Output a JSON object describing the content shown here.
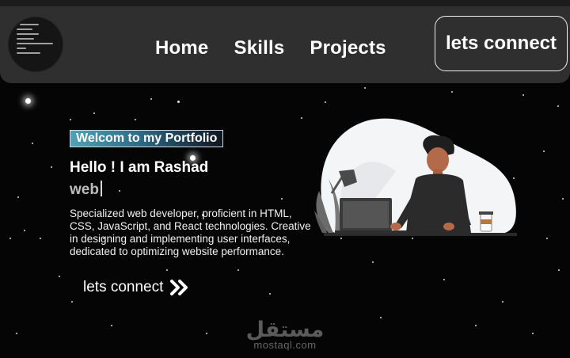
{
  "nav": {
    "links": [
      "Home",
      "Skills",
      "Projects"
    ],
    "cta_label": "lets connect"
  },
  "hero": {
    "badge": "Welcom to my Portfolio",
    "greeting": "Hello ! I am Rashad",
    "typed_text": "web",
    "description_lines": [
      "Specialized web developer, proficient in HTML,",
      "CSS, JavaScript, and React technologies. Creative",
      "in designing and implementing user interfaces,",
      "dedicated to optimizing website performance."
    ],
    "cta_label": "lets connect",
    "cta_icon": "double-chevron-right-icon",
    "illustration": "developer-at-laptop-illustration"
  },
  "logo": {
    "icon": "code-avatar-logo"
  },
  "watermark": {
    "arabic": "مستقل",
    "latin": "mostaql.com"
  },
  "colors": {
    "background": "#050505",
    "navbar": "#2f2f2f",
    "text": "#ffffff",
    "badge_start": "#4fa3b2",
    "muted": "#bdbdbd"
  }
}
